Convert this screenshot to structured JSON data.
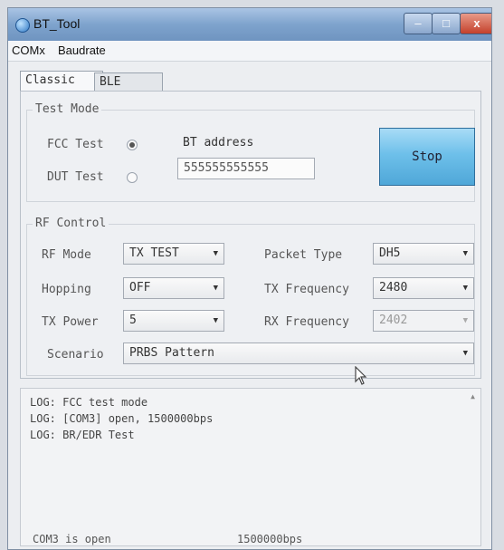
{
  "window": {
    "title": "BT_Tool"
  },
  "title_buttons": {
    "minimize": "–",
    "maximize": "□",
    "close": "x"
  },
  "menu": [
    "COMx",
    "Baudrate"
  ],
  "tabs": [
    {
      "label": "Classic",
      "active": true
    },
    {
      "label": "BLE",
      "active": false
    }
  ],
  "test_mode": {
    "group_label": "Test Mode",
    "fcc_label": "FCC Test",
    "dut_label": "DUT Test",
    "fcc_selected": true,
    "bt_address_label": "BT address",
    "bt_address_value": "555555555555",
    "stop_button": "Stop"
  },
  "rf_control": {
    "group_label": "RF Control",
    "rf_mode_label": "RF Mode",
    "rf_mode_value": "TX TEST",
    "hopping_label": "Hopping",
    "hopping_value": "OFF",
    "tx_power_label": "TX Power",
    "tx_power_value": "5",
    "packet_type_label": "Packet Type",
    "packet_type_value": "DH5",
    "tx_freq_label": "TX Frequency",
    "tx_freq_value": "2480",
    "rx_freq_label": "RX Frequency",
    "rx_freq_value": "2402",
    "scenario_label": "Scenario",
    "scenario_value": "PRBS Pattern"
  },
  "log": {
    "lines": [
      "LOG: FCC test mode",
      "LOG: [COM3] open, 1500000bps",
      "LOG: BR/EDR Test"
    ]
  },
  "status": {
    "port": "COM3 is open",
    "baud": "1500000bps"
  }
}
